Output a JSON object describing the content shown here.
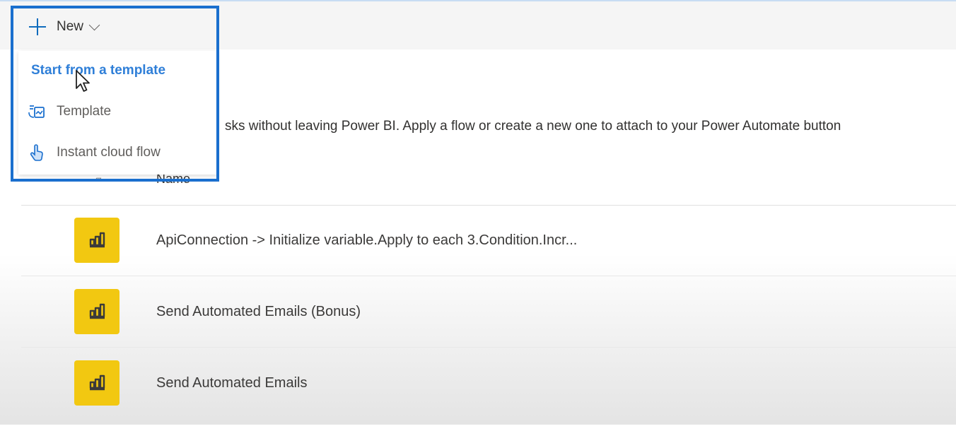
{
  "toolbar": {
    "new_label": "New"
  },
  "dropdown": {
    "heading": "Start from a template",
    "items": [
      {
        "label": "Template",
        "icon": "template-icon"
      },
      {
        "label": "Instant cloud flow",
        "icon": "touch-hand-icon"
      }
    ]
  },
  "description": "sks without leaving Power BI. Apply a flow or create a new one to attach to your Power Automate button",
  "table": {
    "name_header": "Name",
    "rows": [
      {
        "name": "ApiConnection -> Initialize variable.Apply to each 3.Condition.Incr...",
        "icon": "power-bi-icon"
      },
      {
        "name": "Send Automated Emails (Bonus)",
        "icon": "power-bi-icon"
      },
      {
        "name": "Send Automated Emails",
        "icon": "power-bi-icon"
      }
    ]
  },
  "colors": {
    "accent": "#0f6cbd",
    "heading_link": "#2f7fd8",
    "tile": "#f2c811",
    "highlight_border": "#1a6fce"
  }
}
